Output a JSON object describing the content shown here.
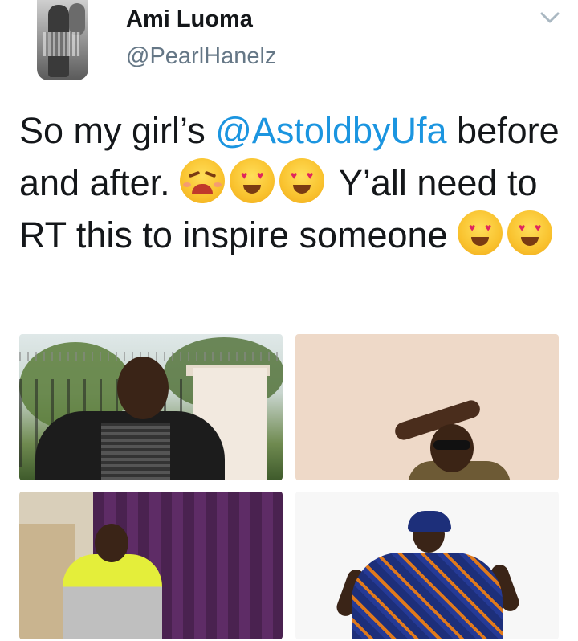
{
  "tweet": {
    "author_name": "Ami Luoma",
    "author_handle": "@PearlHanelz",
    "text_part1": "So my girl’s ",
    "mention": "@AstoldbyUfa",
    "text_part2": " before and after. ",
    "text_part3": " Y’all need to RT this to inspire someone ",
    "emojis_line1": [
      "weary-face",
      "smiling-face-with-heart-eyes",
      "smiling-face-with-heart-eyes"
    ],
    "emojis_line2": [
      "smiling-face-with-heart-eyes",
      "smiling-face-with-heart-eyes"
    ]
  },
  "icons": {
    "menu": "chevron-down-icon"
  },
  "colors": {
    "text": "#14171a",
    "handle": "#657786",
    "mention": "#1b95e0",
    "chevron": "#aab8c2"
  },
  "photos": [
    {
      "id": "photo-before-1"
    },
    {
      "id": "photo-after-1"
    },
    {
      "id": "photo-before-2"
    },
    {
      "id": "photo-after-2"
    }
  ]
}
